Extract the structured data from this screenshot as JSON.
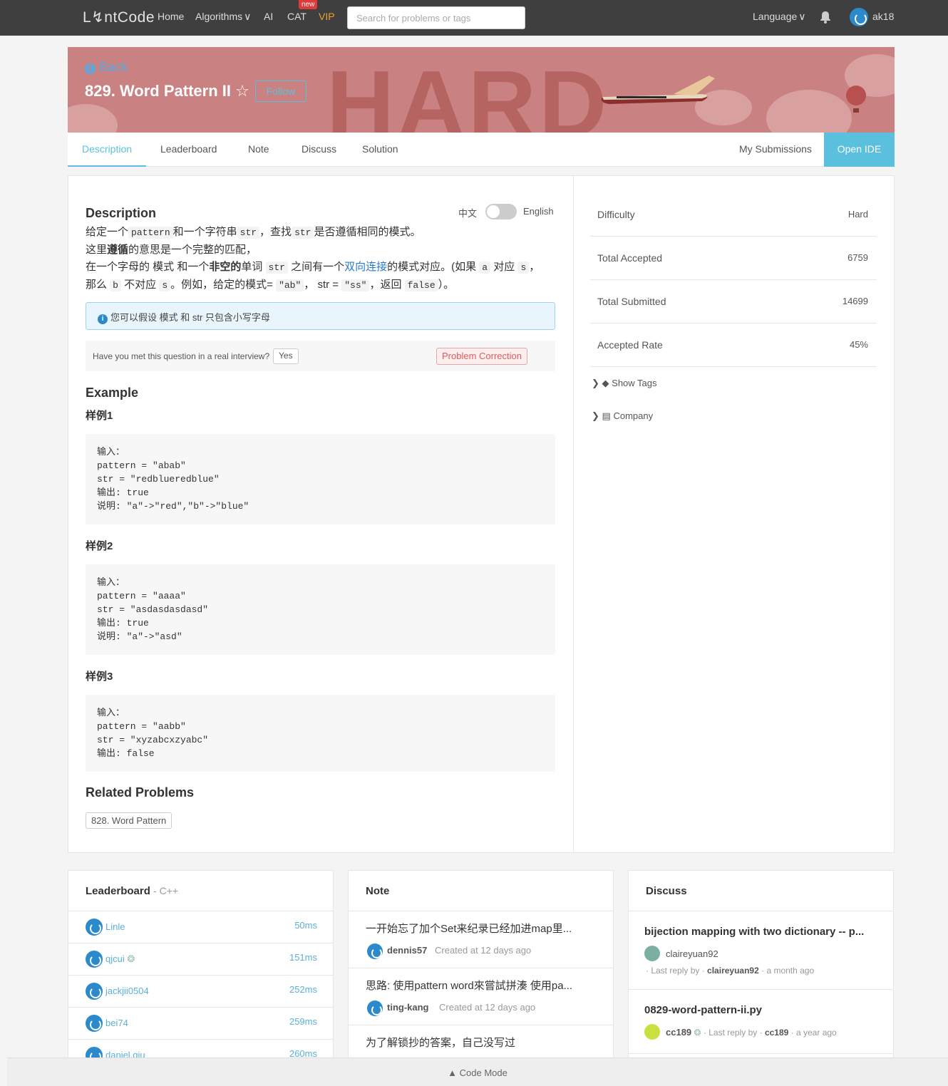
{
  "topbar": {
    "logo": "L↯ntCode",
    "home": "Home",
    "algorithms": "Algorithms",
    "ai": "AI",
    "cat": "CAT",
    "new_badge": "new",
    "vip": "VIP",
    "search_placeholder": "Search for problems or tags",
    "language": "Language",
    "username": "ak18"
  },
  "banner": {
    "back": "Back",
    "title": "829. Word Pattern II",
    "follow": "Follow",
    "difficulty_word": "HARD"
  },
  "tabs": [
    "Description",
    "Leaderboard",
    "Note",
    "Discuss",
    "Solution"
  ],
  "my_submissions": "My Submissions",
  "open_ide": "Open IDE",
  "description": {
    "heading": "Description",
    "lang_cn": "中文",
    "lang_en": "English",
    "tip": "您可以假设 模式 和 str 只包含小写字母",
    "interview_q": "Have you met this question in a real interview?",
    "yes": "Yes",
    "correction": "Problem Correction"
  },
  "example": {
    "heading": "Example",
    "samples": [
      {
        "title": "样例1",
        "code": "输入：\npattern = \"abab\"\nstr = \"redblueredblue\"\n输出: true\n说明: \"a\"->\"red\",\"b\"->\"blue\""
      },
      {
        "title": "样例2",
        "code": "输入：\npattern = \"aaaa\"\nstr = \"asdasdasdasd\"\n输出: true\n说明: \"a\"->\"asd\""
      },
      {
        "title": "样例3",
        "code": "输入：\npattern = \"aabb\"\nstr = \"xyzabcxzyabc\"\n输出: false"
      }
    ]
  },
  "related": {
    "heading": "Related Problems",
    "item": "828. Word Pattern"
  },
  "stats": [
    {
      "k": "Difficulty",
      "v": "Hard"
    },
    {
      "k": "Total Accepted",
      "v": "6759"
    },
    {
      "k": "Total Submitted",
      "v": "14699"
    },
    {
      "k": "Accepted Rate",
      "v": "45%"
    }
  ],
  "show_tags": "Show Tags",
  "company": "Company",
  "leaderboard": {
    "title": "Leaderboard",
    "lang": "- C++",
    "rows": [
      {
        "name": "Linle",
        "time": "50ms"
      },
      {
        "name": "qjcui",
        "time": "151ms"
      },
      {
        "name": "jackjii0504",
        "time": "252ms"
      },
      {
        "name": "bei74",
        "time": "259ms"
      },
      {
        "name": "daniel.qiu",
        "time": "260ms"
      }
    ]
  },
  "note": {
    "title": "Note",
    "items": [
      {
        "text": "一开始忘了加个Set来纪录已经加进map里...",
        "user": "dennis57",
        "meta": "Created at 12 days ago"
      },
      {
        "text": "思路: 使用pattern word來嘗試拼湊 使用pa...",
        "user": "ting-kang",
        "meta": "Created at 12 days ago"
      },
      {
        "text": "为了解锁抄的答案，自己没写过",
        "user": "",
        "meta": ""
      }
    ]
  },
  "discuss": {
    "title": "Discuss",
    "items": [
      {
        "title": "bijection mapping with two dictionary -- p...",
        "user": "claireyuan92",
        "last_by": "· Last reply by ·",
        "last_user": "claireyuan92",
        "ago": "· a month ago"
      },
      {
        "title": "0829-word-pattern-ii.py",
        "user": "cc189",
        "last_by": "· Last reply by ·",
        "last_user": "cc189",
        "ago": "· a year ago"
      }
    ]
  },
  "code_mode": "Code Mode",
  "colors": {
    "accent": "#5bc0de",
    "banner": "#c98281",
    "topbar": "#3f3f3f",
    "danger": "#e05a5a"
  }
}
